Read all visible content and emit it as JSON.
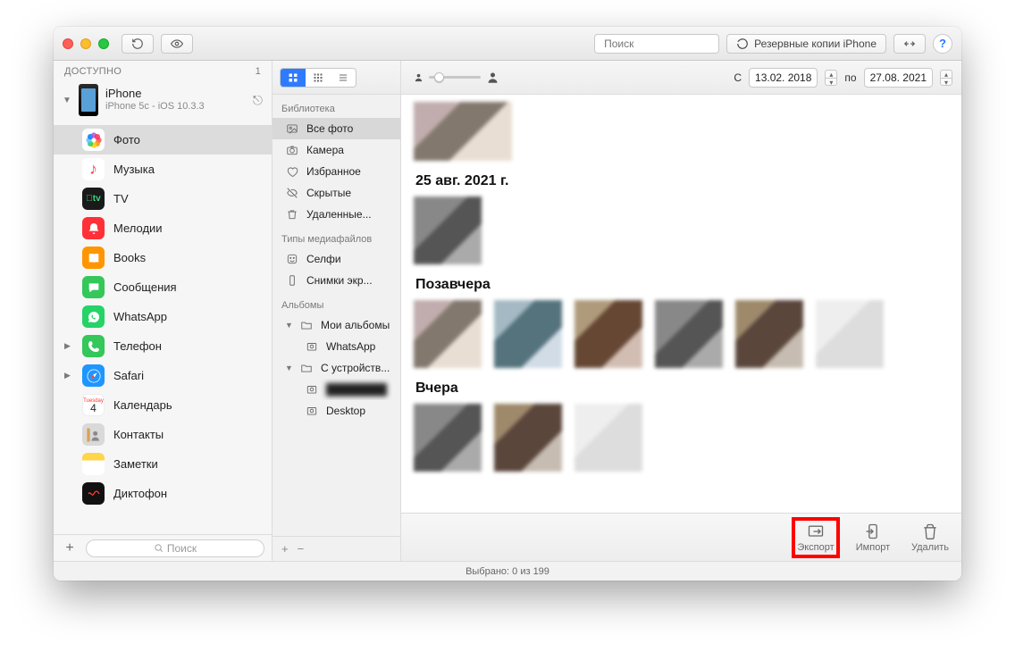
{
  "toolbar": {
    "search_placeholder": "Поиск",
    "backups_label": "Резервные копии iPhone",
    "help_label": "?"
  },
  "sidebar": {
    "section_title": "ДОСТУПНО",
    "device_count": "1",
    "device": {
      "name": "iPhone",
      "sub": "iPhone 5c - iOS 10.3.3"
    },
    "items": [
      {
        "label": "Фото",
        "key": "photos",
        "selected": true
      },
      {
        "label": "Музыка",
        "key": "music"
      },
      {
        "label": "TV",
        "key": "tv"
      },
      {
        "label": "Мелодии",
        "key": "ringtones"
      },
      {
        "label": "Books",
        "key": "books"
      },
      {
        "label": "Сообщения",
        "key": "messages"
      },
      {
        "label": "WhatsApp",
        "key": "whatsapp"
      },
      {
        "label": "Телефон",
        "key": "phone",
        "disclosure": true
      },
      {
        "label": "Safari",
        "key": "safari",
        "disclosure": true
      },
      {
        "label": "Календарь",
        "key": "calendar"
      },
      {
        "label": "Контакты",
        "key": "contacts"
      },
      {
        "label": "Заметки",
        "key": "notes"
      },
      {
        "label": "Диктофон",
        "key": "voicememo"
      }
    ],
    "calendar_day": "4",
    "calendar_weekday": "Tuesday",
    "footer_search_placeholder": "Поиск"
  },
  "library": {
    "section_library": "Библиотека",
    "items_library": [
      {
        "label": "Все фото",
        "icon": "photo",
        "selected": true
      },
      {
        "label": "Камера",
        "icon": "camera"
      },
      {
        "label": "Избранное",
        "icon": "heart"
      },
      {
        "label": "Скрытые",
        "icon": "hidden"
      },
      {
        "label": "Удаленные...",
        "icon": "trash"
      }
    ],
    "section_media": "Типы медиафайлов",
    "items_media": [
      {
        "label": "Селфи",
        "icon": "selfie"
      },
      {
        "label": "Снимки экр...",
        "icon": "device"
      }
    ],
    "section_albums": "Альбомы",
    "items_albums": [
      {
        "label": "Мои альбомы",
        "icon": "folder",
        "disclosure": "▼",
        "children": [
          {
            "label": "WhatsApp"
          }
        ]
      },
      {
        "label": "С устройств...",
        "icon": "folder",
        "disclosure": "▼",
        "children": [
          {
            "label": "",
            "blurred": true
          },
          {
            "label": "Desktop"
          }
        ]
      }
    ]
  },
  "daterange": {
    "from_label": "С",
    "from_value": "13.02. 2018",
    "to_label": "по",
    "to_value": "27.08. 2021"
  },
  "groups": [
    {
      "title": "",
      "count": 1,
      "big": true
    },
    {
      "title": "25 авг. 2021 г.",
      "count": 1
    },
    {
      "title": "Позавчера",
      "count": 6
    },
    {
      "title": "Вчера",
      "count": 3
    }
  ],
  "actions": {
    "export": "Экспорт",
    "import": "Импорт",
    "delete": "Удалить"
  },
  "status": "Выбрано: 0 из 199"
}
